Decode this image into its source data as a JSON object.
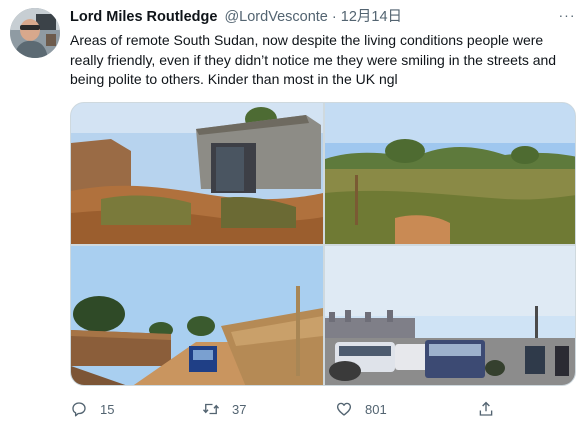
{
  "tweet": {
    "author_name": "Lord Miles Routledge",
    "handle": "@LordVesconte",
    "separator": "·",
    "timestamp": "12月14日",
    "more_label": "···",
    "text": "Areas of remote South Sudan, now despite the living conditions people were really friendly, even if they didn’t notice me they were smiling in the streets and being polite to others. Kinder than most in the UK ngl"
  },
  "actions": {
    "reply_count": "15",
    "retweet_count": "37",
    "like_count": "801"
  },
  "icons": {
    "reply": "reply-icon",
    "retweet": "retweet-icon",
    "like": "heart-icon",
    "share": "share-icon",
    "more": "more-icon"
  },
  "colors": {
    "text_primary": "#0f1419",
    "text_secondary": "#536471",
    "border": "#cfd9de"
  }
}
